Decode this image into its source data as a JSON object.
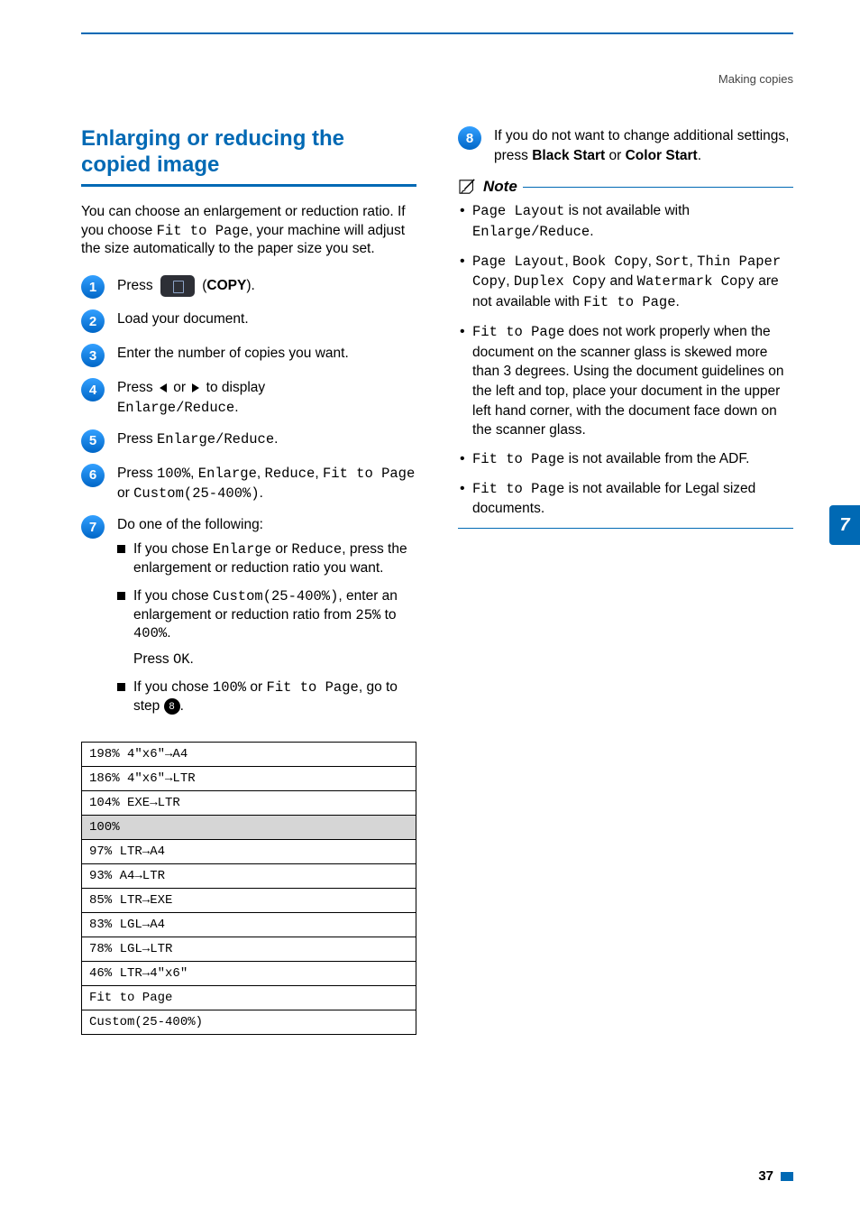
{
  "breadcrumb": "Making copies",
  "side_tab": "7",
  "page_number": "37",
  "title": "Enlarging or reducing the copied image",
  "intro": {
    "pre": "You can choose an enlargement or reduction ratio. If you choose ",
    "code": "Fit to Page",
    "post": ", your machine will adjust the size automatically to the paper size you set."
  },
  "steps": {
    "s1": {
      "pre": "Press ",
      "post_icon_pre": " (",
      "bold": "COPY",
      "post": ")."
    },
    "s2": "Load your document.",
    "s3": "Enter the number of copies you want.",
    "s4": {
      "pre": "Press ",
      "mid": " or ",
      "post": " to display",
      "code": "Enlarge/Reduce",
      "end": "."
    },
    "s5": {
      "pre": "Press ",
      "code": "Enlarge/Reduce",
      "post": "."
    },
    "s6": {
      "pre": "Press ",
      "c1": "100%",
      "sep1": ", ",
      "c2": "Enlarge",
      "sep2": ", ",
      "c3": "Reduce",
      "sep3": ", ",
      "c4": "Fit to Page",
      "or": " or ",
      "c5": "Custom(25-400%)",
      "end": "."
    },
    "s7": {
      "lead": "Do one of the following:",
      "a": {
        "pre": "If you chose ",
        "c1": "Enlarge",
        "mid": " or ",
        "c2": "Reduce",
        "post": ", press the enlargement or reduction ratio you want."
      },
      "b": {
        "pre": "If you chose ",
        "c1": "Custom(25-400%)",
        "mid": ", enter an enlargement or reduction ratio from ",
        "c2": "25%",
        "mid2": " to ",
        "c3": "400%",
        "end": ".",
        "press": "Press ",
        "ok": "OK",
        "end2": "."
      },
      "c": {
        "pre": "If you chose ",
        "c1": "100%",
        "mid": " or ",
        "c2": "Fit to Page",
        "post": ", go to step ",
        "ref": "8",
        "end": "."
      }
    },
    "s8": {
      "pre": "If you do not want to change additional settings, press ",
      "b1": "Black Start",
      "mid": " or ",
      "b2": "Color Start",
      "end": "."
    }
  },
  "ratios": [
    "198% 4\"x6\"→A4",
    "186% 4\"x6\"→LTR",
    "104% EXE→LTR",
    "100%",
    "97% LTR→A4",
    "93% A4→LTR",
    "85% LTR→EXE",
    "83% LGL→A4",
    "78% LGL→LTR",
    "46% LTR→4\"x6\"",
    "Fit to Page",
    "Custom(25-400%)"
  ],
  "note": {
    "title": "Note",
    "n1": {
      "c1": "Page Layout",
      "mid": " is not available with ",
      "c2": "Enlarge/Reduce",
      "end": "."
    },
    "n2": {
      "c1": "Page Layout",
      "s1": ", ",
      "c2": "Book Copy",
      "s2": ", ",
      "c3": "Sort",
      "s3": ", ",
      "c4": "Thin Paper Copy",
      "s4": ", ",
      "c5": "Duplex Copy",
      "mid": " and ",
      "c6": "Watermark Copy",
      "post": " are not available with ",
      "c7": "Fit to Page",
      "end": "."
    },
    "n3": {
      "c1": "Fit to Page",
      "post": " does not work properly when the document on the scanner glass is skewed more than 3 degrees. Using the document guidelines on the left and top, place your document in the upper left hand corner, with the document face down on the scanner glass."
    },
    "n4": {
      "c1": "Fit to Page",
      "post": " is not available from the ADF."
    },
    "n5": {
      "c1": "Fit to Page",
      "post": " is not available for Legal sized documents."
    }
  }
}
